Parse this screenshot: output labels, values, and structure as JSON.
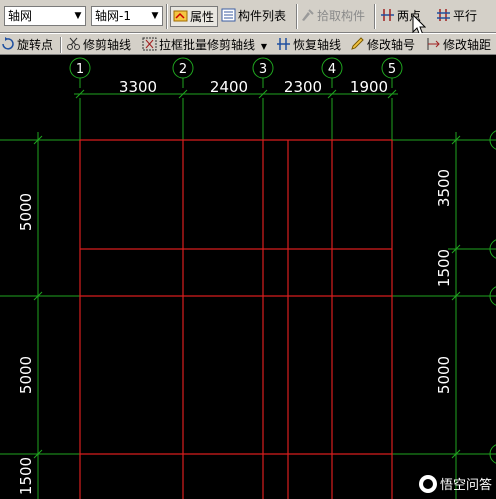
{
  "toolbar1": {
    "select_type": "轴网",
    "select_instance": "轴网-1",
    "btn_properties": "属性",
    "btn_component_list": "构件列表",
    "btn_pick_component": "拾取构件",
    "btn_two_points": "两点",
    "btn_parallel": "平行"
  },
  "toolbar2": {
    "rotate_point": "旋转点",
    "trim_axis": "修剪轴线",
    "batch_trim_axis": "拉框批量修剪轴线",
    "restore_axis": "恢复轴线",
    "edit_axis_no": "修改轴号",
    "edit_axis_distance": "修改轴距"
  },
  "grid": {
    "top_axis_numbers": [
      "1",
      "2",
      "3",
      "4",
      "5"
    ],
    "top_dimensions": [
      "3300",
      "2400",
      "2300",
      "1900"
    ],
    "left_dimensions": [
      "5000",
      "5000",
      "1500"
    ],
    "right_dimensions": [
      "3500",
      "1500",
      "5000"
    ]
  },
  "colors": {
    "axis_line": "#d81e1e",
    "dimension": "#1fa51f",
    "text": "#ffffff",
    "background": "#000000"
  },
  "watermark": "悟空问答"
}
